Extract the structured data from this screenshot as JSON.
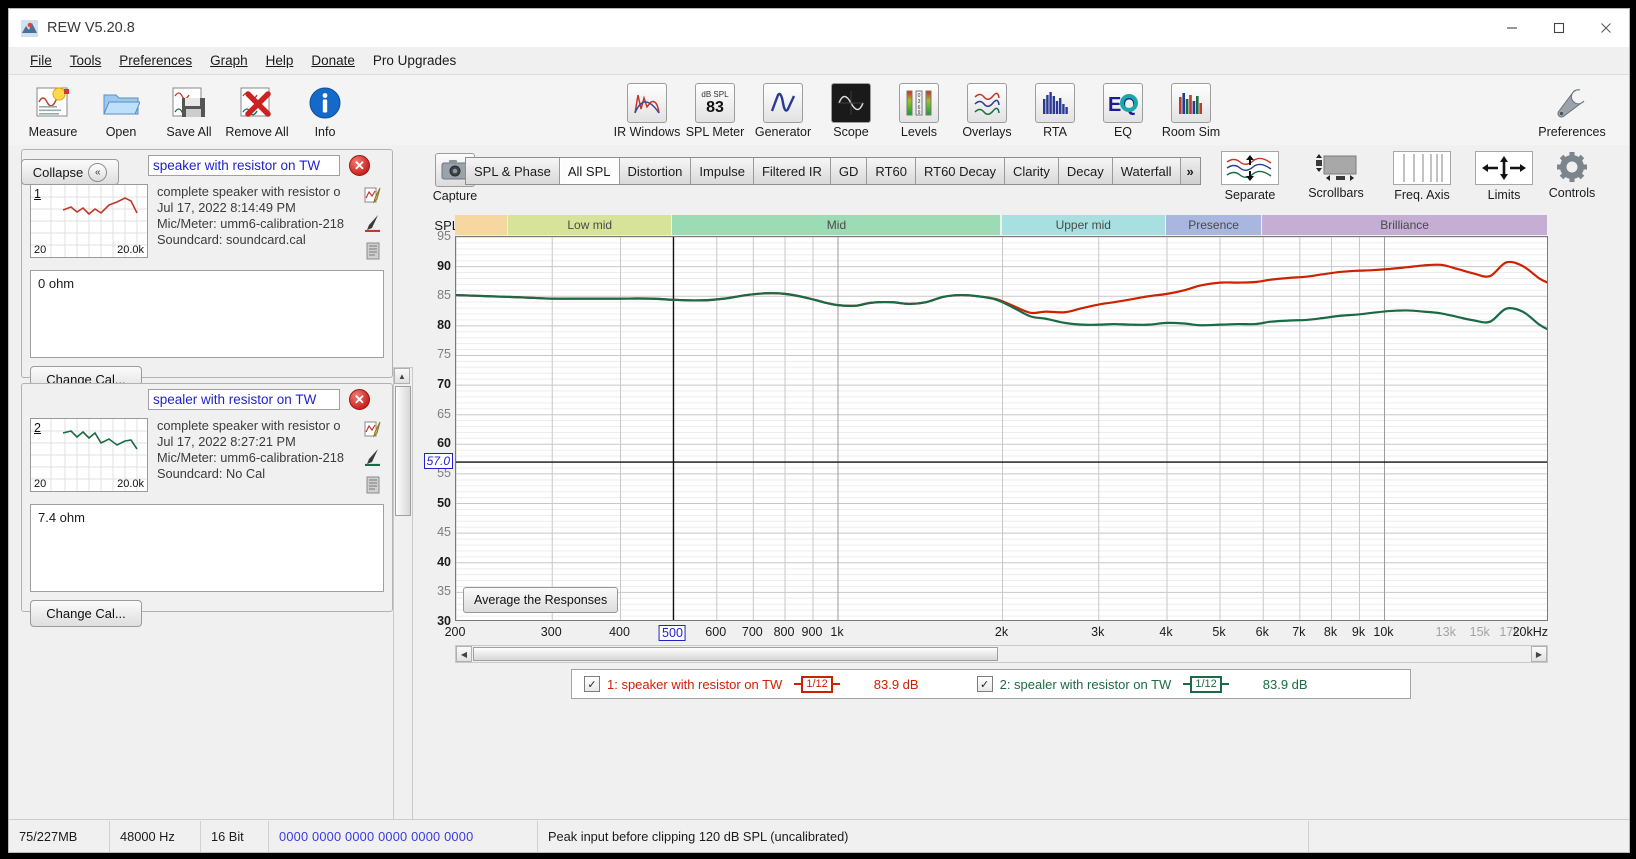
{
  "window": {
    "title": "REW V5.20.8",
    "minimize": "—",
    "maximize": "☐",
    "close": "✕"
  },
  "menu": {
    "items": [
      "File",
      "Tools",
      "Preferences",
      "Graph",
      "Help",
      "Donate",
      "Pro Upgrades"
    ]
  },
  "toolbar": {
    "left": [
      {
        "label": "Measure",
        "icon": "measure-icon"
      },
      {
        "label": "Open",
        "icon": "folder-open-icon"
      },
      {
        "label": "Save All",
        "icon": "save-icon"
      },
      {
        "label": "Remove All",
        "icon": "remove-icon"
      },
      {
        "label": "Info",
        "icon": "info-icon"
      }
    ],
    "center": [
      {
        "label": "IR Windows",
        "icon": "ir-windows-icon"
      },
      {
        "label": "SPL Meter",
        "icon": "spl-meter-icon",
        "value": "83",
        "unit": "dB SPL"
      },
      {
        "label": "Generator",
        "icon": "generator-icon"
      },
      {
        "label": "Scope",
        "icon": "scope-icon"
      },
      {
        "label": "Levels",
        "icon": "levels-icon"
      },
      {
        "label": "Overlays",
        "icon": "overlays-icon"
      },
      {
        "label": "RTA",
        "icon": "rta-icon"
      },
      {
        "label": "EQ",
        "icon": "eq-icon"
      },
      {
        "label": "Room Sim",
        "icon": "room-sim-icon"
      }
    ],
    "right": [
      {
        "label": "Preferences",
        "icon": "wrench-icon"
      }
    ]
  },
  "left_panel": {
    "collapse_label": "Collapse",
    "collapse_icon": "«",
    "measurements": [
      {
        "index": "1",
        "name": "speaker with resistor on TW",
        "description": "complete speaker with resistor o",
        "timestamp": "Jul 17, 2022 8:14:49 PM",
        "mic": "Mic/Meter: umm6-calibration-218",
        "soundcard": "Soundcard: soundcard.cal",
        "notes": "0 ohm",
        "thumb_low": "20",
        "thumb_high": "20.0k",
        "color": "#c0392b",
        "change_cal_label": "Change Cal..."
      },
      {
        "index": "2",
        "name": "spealer with resistor on TW",
        "description": "complete speaker with resistor o",
        "timestamp": "Jul 17, 2022 8:27:21 PM",
        "mic": "Mic/Meter: umm6-calibration-218",
        "soundcard": "Soundcard: No Cal",
        "notes": "7.4 ohm",
        "thumb_low": "20",
        "thumb_high": "20.0k",
        "color": "#1a6b45",
        "change_cal_label": "Change Cal..."
      }
    ]
  },
  "graph_panel": {
    "capture_label": "Capture",
    "tabs": [
      {
        "label": "SPL & Phase",
        "active": false
      },
      {
        "label": "All SPL",
        "active": true
      },
      {
        "label": "Distortion",
        "active": false
      },
      {
        "label": "Impulse",
        "active": false
      },
      {
        "label": "Filtered IR",
        "active": false
      },
      {
        "label": "GD",
        "active": false
      },
      {
        "label": "RT60",
        "active": false
      },
      {
        "label": "RT60 Decay",
        "active": false
      },
      {
        "label": "Clarity",
        "active": false
      },
      {
        "label": "Decay",
        "active": false
      },
      {
        "label": "Waterfall",
        "active": false
      },
      {
        "label": "»",
        "active": false,
        "more": true
      }
    ],
    "right_buttons": [
      {
        "label": "Separate",
        "icon": "separate-icon"
      },
      {
        "label": "Scrollbars",
        "icon": "scrollbars-icon"
      },
      {
        "label": "Freq. Axis",
        "icon": "freq-axis-icon"
      },
      {
        "label": "Limits",
        "icon": "limits-icon"
      },
      {
        "label": "Controls",
        "icon": "gear-icon"
      }
    ],
    "average_button": "Average the Responses",
    "spl_caption": "SPL"
  },
  "legend": {
    "items": [
      {
        "checked": "✓",
        "label": "1: speaker with resistor on TW",
        "smoothing_num": "1",
        "smoothing_den": "12",
        "value": "83.9 dB",
        "color": "#cc2200"
      },
      {
        "checked": "✓",
        "label": "2: spealer with resistor on TW",
        "smoothing_num": "1",
        "smoothing_den": "12",
        "value": "83.9 dB",
        "color": "#1a6b45"
      }
    ]
  },
  "status_bar": {
    "memory": "75/227MB",
    "sample_rate": "48000 Hz",
    "bit_depth": "16 Bit",
    "bits": "0000 0000  0000 0000  0000 0000",
    "message": "Peak input before clipping 120 dB SPL (uncalibrated)"
  },
  "chart_data": {
    "type": "line",
    "title": "All SPL",
    "xlabel": "",
    "ylabel": "SPL",
    "x_unit": "20kHz",
    "xscale": "log",
    "xlim": [
      200,
      20000
    ],
    "ylim": [
      30,
      95
    ],
    "y_ticks": [
      {
        "value": 95,
        "label": "95",
        "major": false
      },
      {
        "value": 90,
        "label": "90",
        "major": true
      },
      {
        "value": 85,
        "label": "85",
        "major": false
      },
      {
        "value": 80,
        "label": "80",
        "major": true
      },
      {
        "value": 75,
        "label": "75",
        "major": false
      },
      {
        "value": 70,
        "label": "70",
        "major": true
      },
      {
        "value": 65,
        "label": "65",
        "major": false
      },
      {
        "value": 60,
        "label": "60",
        "major": true
      },
      {
        "value": 55,
        "label": "55",
        "major": false
      },
      {
        "value": 50,
        "label": "50",
        "major": true
      },
      {
        "value": 45,
        "label": "45",
        "major": false
      },
      {
        "value": 40,
        "label": "40",
        "major": true
      },
      {
        "value": 35,
        "label": "35",
        "major": false
      },
      {
        "value": 30,
        "label": "30",
        "major": true
      }
    ],
    "cursor_y": {
      "value": 57.0,
      "label": "57.0"
    },
    "cursor_x": {
      "value": 500,
      "label": "500"
    },
    "x_ticks": [
      {
        "value": 200,
        "label": "200",
        "dim": false
      },
      {
        "value": 300,
        "label": "300",
        "dim": false
      },
      {
        "value": 400,
        "label": "400",
        "dim": false
      },
      {
        "value": 500,
        "label": "500",
        "dim": false,
        "selected": true
      },
      {
        "value": 600,
        "label": "600",
        "dim": false
      },
      {
        "value": 700,
        "label": "700",
        "dim": false
      },
      {
        "value": 800,
        "label": "800",
        "dim": false
      },
      {
        "value": 900,
        "label": "900",
        "dim": false
      },
      {
        "value": 1000,
        "label": "1k",
        "dim": false
      },
      {
        "value": 2000,
        "label": "2k",
        "dim": false
      },
      {
        "value": 3000,
        "label": "3k",
        "dim": false
      },
      {
        "value": 4000,
        "label": "4k",
        "dim": false
      },
      {
        "value": 5000,
        "label": "5k",
        "dim": false
      },
      {
        "value": 6000,
        "label": "6k",
        "dim": false
      },
      {
        "value": 7000,
        "label": "7k",
        "dim": false
      },
      {
        "value": 8000,
        "label": "8k",
        "dim": false
      },
      {
        "value": 9000,
        "label": "9k",
        "dim": false
      },
      {
        "value": 10000,
        "label": "10k",
        "dim": false
      },
      {
        "value": 13000,
        "label": "13k",
        "dim": true
      },
      {
        "value": 15000,
        "label": "15k",
        "dim": true
      },
      {
        "value": 17000,
        "label": "17k",
        "dim": true
      },
      {
        "value": 20000,
        "label": "20kHz",
        "dim": false
      }
    ],
    "bands": [
      {
        "label": "",
        "from": 200,
        "to": 250,
        "color": "#f7d7a0"
      },
      {
        "label": "Low mid",
        "from": 250,
        "to": 500,
        "color": "#d8e39a"
      },
      {
        "label": "Mid",
        "from": 500,
        "to": 2000,
        "color": "#9bdcb4"
      },
      {
        "label": "Upper mid",
        "from": 2000,
        "to": 4000,
        "color": "#a8dfe0"
      },
      {
        "label": "Presence",
        "from": 4000,
        "to": 6000,
        "color": "#a9b6e0"
      },
      {
        "label": "Brilliance",
        "from": 6000,
        "to": 20000,
        "color": "#c4aed4"
      }
    ],
    "grid": true,
    "legend_position": "bottom",
    "series": [
      {
        "name": "1: speaker with resistor on TW",
        "color": "#cc2200",
        "x": [
          200,
          230,
          265,
          300,
          345,
          395,
          455,
          500,
          560,
          620,
          680,
          740,
          800,
          870,
          940,
          1000,
          1080,
          1150,
          1250,
          1350,
          1450,
          1560,
          1680,
          1800,
          1950,
          2100,
          2250,
          2400,
          2600,
          2800,
          3000,
          3200,
          3450,
          3700,
          4000,
          4300,
          4600,
          5000,
          5400,
          5800,
          6200,
          6700,
          7200,
          7700,
          8300,
          8900,
          9500,
          10200,
          11000,
          11800,
          12700,
          13600,
          14600,
          15600,
          16700,
          17900,
          19200,
          20000
        ],
        "y": [
          85.2,
          85.0,
          84.8,
          84.6,
          84.6,
          84.6,
          84.6,
          84.4,
          84.3,
          84.6,
          85.2,
          85.5,
          85.4,
          84.8,
          84.0,
          83.5,
          83.4,
          83.9,
          84.0,
          83.7,
          84.0,
          84.9,
          85.2,
          85.0,
          84.5,
          83.3,
          82.2,
          82.4,
          82.3,
          83.0,
          83.6,
          84.0,
          84.5,
          85.0,
          85.4,
          86.0,
          86.8,
          87.3,
          87.3,
          87.4,
          87.8,
          88.1,
          88.3,
          88.7,
          89.1,
          89.3,
          89.4,
          89.6,
          89.9,
          90.2,
          90.3,
          89.6,
          88.8,
          88.4,
          90.7,
          90.1,
          88.0,
          87.2
        ]
      },
      {
        "name": "2: spealer with resistor on TW",
        "color": "#1a6b45",
        "x": [
          200,
          230,
          265,
          300,
          345,
          395,
          455,
          500,
          560,
          620,
          680,
          740,
          800,
          870,
          940,
          1000,
          1080,
          1150,
          1250,
          1350,
          1450,
          1560,
          1680,
          1800,
          1950,
          2100,
          2250,
          2400,
          2600,
          2800,
          3000,
          3200,
          3450,
          3700,
          4000,
          4300,
          4600,
          5000,
          5400,
          5800,
          6200,
          6700,
          7200,
          7700,
          8300,
          8900,
          9500,
          10200,
          11000,
          11800,
          12700,
          13600,
          14600,
          15600,
          16700,
          17900,
          19200,
          20000
        ],
        "y": [
          85.2,
          85.0,
          84.8,
          84.6,
          84.6,
          84.6,
          84.6,
          84.4,
          84.3,
          84.6,
          85.2,
          85.5,
          85.4,
          84.8,
          84.0,
          83.5,
          83.4,
          83.9,
          84.0,
          83.7,
          84.0,
          84.9,
          85.2,
          85.0,
          84.4,
          83.0,
          81.6,
          81.2,
          80.5,
          80.2,
          80.2,
          80.3,
          80.2,
          80.2,
          80.5,
          80.4,
          80.1,
          80.2,
          80.3,
          80.3,
          80.7,
          80.9,
          81.0,
          81.3,
          81.7,
          81.9,
          82.2,
          82.5,
          82.6,
          82.4,
          82.1,
          81.5,
          80.9,
          80.7,
          82.9,
          82.4,
          80.2,
          79.3
        ]
      }
    ]
  }
}
